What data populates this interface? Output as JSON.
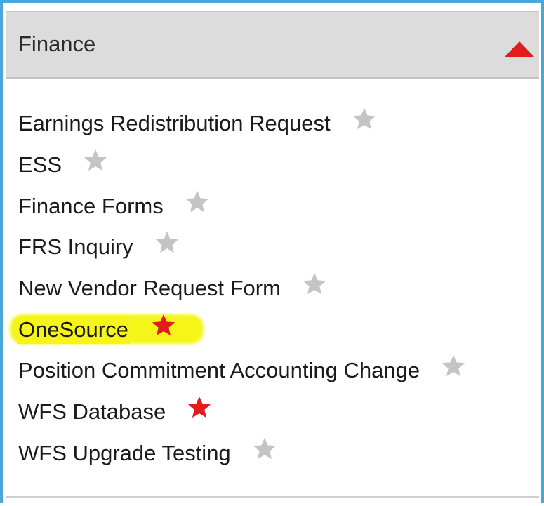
{
  "panel": {
    "title": "Finance",
    "collapse_icon": "triangle-up-icon"
  },
  "colors": {
    "frame_border": "#4aa8d8",
    "header_background": "#dcdcdc",
    "favorite_star": "#e21c1c",
    "unfavorite_star": "#c4c4c4",
    "highlight": "#f5f51a"
  },
  "items": [
    {
      "label": "Earnings Redistribution Request",
      "favorite": false,
      "highlighted": false
    },
    {
      "label": "ESS",
      "favorite": false,
      "highlighted": false
    },
    {
      "label": "Finance Forms",
      "favorite": false,
      "highlighted": false
    },
    {
      "label": "FRS Inquiry",
      "favorite": false,
      "highlighted": false
    },
    {
      "label": "New Vendor Request Form",
      "favorite": false,
      "highlighted": false
    },
    {
      "label": "OneSource",
      "favorite": true,
      "highlighted": true
    },
    {
      "label": "Position Commitment Accounting Change",
      "favorite": false,
      "highlighted": false
    },
    {
      "label": "WFS Database",
      "favorite": true,
      "highlighted": false
    },
    {
      "label": "WFS Upgrade Testing",
      "favorite": false,
      "highlighted": false
    }
  ]
}
